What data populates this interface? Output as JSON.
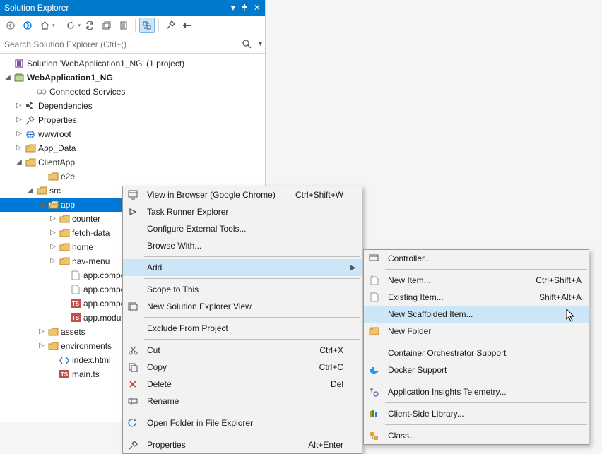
{
  "panel": {
    "title": "Solution Explorer",
    "search_placeholder": "Search Solution Explorer (Ctrl+;)"
  },
  "tree": {
    "solution": "Solution 'WebApplication1_NG' (1 project)",
    "project": "WebApplication1_NG",
    "items": [
      "Connected Services",
      "Dependencies",
      "Properties",
      "wwwroot",
      "App_Data",
      "ClientApp",
      "e2e",
      "src",
      "app",
      "counter",
      "fetch-data",
      "home",
      "nav-menu",
      "app.component.css",
      "app.component.html",
      "app.component.ts",
      "app.module.ts",
      "assets",
      "environments",
      "index.html",
      "main.ts"
    ]
  },
  "ctx1": {
    "view_in_browser": "View in Browser (Google Chrome)",
    "view_in_browser_sc": "Ctrl+Shift+W",
    "task_runner": "Task Runner Explorer",
    "config_tools": "Configure External Tools...",
    "browse_with": "Browse With...",
    "add": "Add",
    "scope": "Scope to This",
    "new_se_view": "New Solution Explorer View",
    "exclude": "Exclude From Project",
    "cut": "Cut",
    "cut_sc": "Ctrl+X",
    "copy": "Copy",
    "copy_sc": "Ctrl+C",
    "delete": "Delete",
    "delete_sc": "Del",
    "rename": "Rename",
    "open_folder": "Open Folder in File Explorer",
    "properties": "Properties",
    "properties_sc": "Alt+Enter"
  },
  "ctx2": {
    "controller": "Controller...",
    "new_item": "New Item...",
    "new_item_sc": "Ctrl+Shift+A",
    "existing_item": "Existing Item...",
    "existing_item_sc": "Shift+Alt+A",
    "new_scaffolded": "New Scaffolded Item...",
    "new_folder": "New Folder",
    "container": "Container Orchestrator Support",
    "docker": "Docker Support",
    "app_insights": "Application Insights Telemetry...",
    "client_lib": "Client-Side Library...",
    "class": "Class..."
  }
}
